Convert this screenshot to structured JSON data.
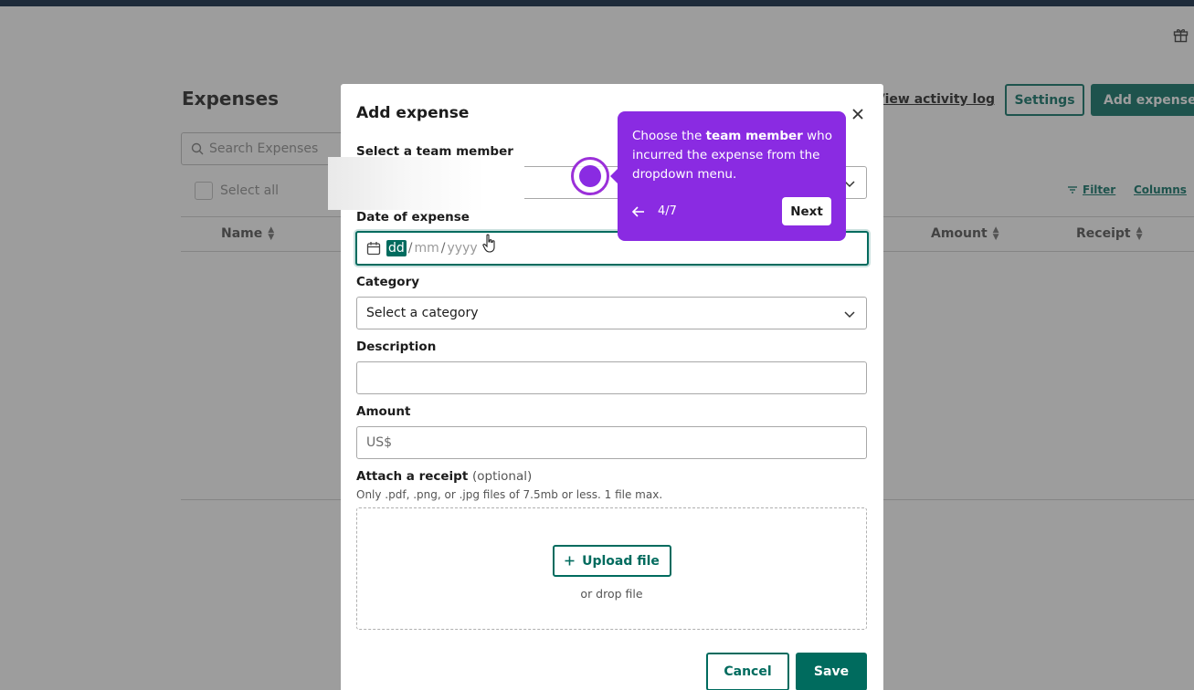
{
  "page": {
    "title": "Expenses",
    "activity_log": "View activity log",
    "settings": "Settings",
    "add_expense": "Add expense",
    "search_placeholder": "Search Expenses",
    "select_all": "Select all",
    "filter": "Filter",
    "columns": "Columns",
    "table_headers": {
      "name": "Name",
      "amount": "Amount",
      "receipt": "Receipt"
    }
  },
  "modal": {
    "title": "Add expense",
    "team_member_label": "Select a team member",
    "date_label": "Date of expense",
    "date_segments": {
      "dd": "dd",
      "mm": "mm",
      "yyyy": "yyyy",
      "sep": "/"
    },
    "category_label": "Category",
    "category_value": "Select a category",
    "description_label": "Description",
    "amount_label": "Amount",
    "amount_placeholder": "US$",
    "receipt_label": "Attach a receipt",
    "receipt_optional": "(optional)",
    "receipt_hint": "Only .pdf, .png, or .jpg files of 7.5mb or less. 1 file max.",
    "upload_button": "Upload file",
    "drop_text": "or drop file",
    "cancel": "Cancel",
    "save": "Save"
  },
  "tour": {
    "text_before": "Choose the ",
    "text_bold": "team member",
    "text_after": " who incurred the expense from the dropdown menu.",
    "step": "4/7",
    "next": "Next"
  },
  "colors": {
    "primary": "#006b5e",
    "tour": "#8a2be2"
  }
}
